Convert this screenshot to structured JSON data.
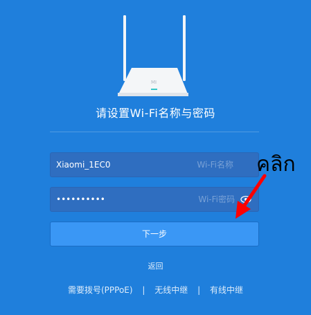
{
  "heading": "请设置Wi-Fi名称与密码",
  "ssid_field": {
    "value": "Xiaomi_1EC0",
    "suffix": "Wi-Fi名称"
  },
  "password_field": {
    "value": "••••••••••",
    "suffix": "Wi-Fi密码"
  },
  "next_button": "下一步",
  "back_link": "返回",
  "footer": {
    "pppoe": "需要拨号(PPPoE)",
    "wireless_repeater": "无线中继",
    "wired_repeater": "有线中继",
    "separator": "|"
  },
  "annotation": {
    "text": "คลิก",
    "color": "#ff0000"
  },
  "router_logo": "mi-logo"
}
